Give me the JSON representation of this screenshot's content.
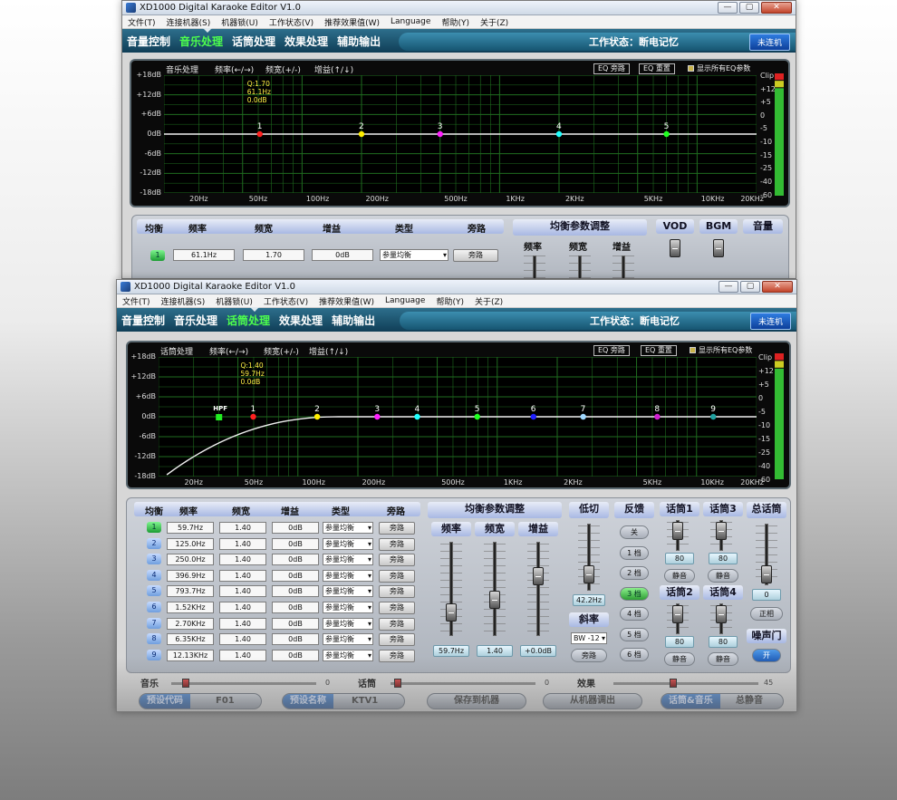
{
  "app": {
    "title": "XD1000 Digital Karaoke Editor V1.0",
    "menu": [
      "文件(T)",
      "连接机器(S)",
      "机器锁(U)",
      "工作状态(V)",
      "推荐效果值(W)",
      "Language",
      "帮助(Y)",
      "关于(Z)"
    ],
    "nav_tabs": [
      "音量控制",
      "音乐处理",
      "话筒处理",
      "效果处理",
      "辅助输出"
    ],
    "status_text": "工作状态：断电记忆",
    "connect_button": "未连机",
    "window_buttons": [
      "—",
      "▢",
      "✕"
    ]
  },
  "back_window": {
    "active_tab": "音乐处理",
    "eq_header": {
      "section": "音乐处理",
      "freq_hint": "频率(←/→)",
      "bw_hint": "频宽(+/-)",
      "gain_hint": "增益(↑/↓)",
      "bypass_btn": "EQ 旁路",
      "reset_btn": "EQ 重置",
      "show_all": "显示所有EQ参数"
    },
    "tooltip": [
      "Q:1.70",
      "61.1Hz",
      "0.0dB"
    ],
    "points": [
      "1",
      "2",
      "3",
      "4",
      "5"
    ],
    "table_headers": [
      "均衡",
      "频率",
      "频宽",
      "增益",
      "类型",
      "旁路"
    ],
    "row": {
      "num": "1",
      "freq": "61.1Hz",
      "bw": "1.70",
      "gain": "0dB",
      "type": "参量均衡",
      "bypass": "旁路"
    },
    "adjust_title": "均衡参数调整",
    "adjust_cols": [
      "频率",
      "频宽",
      "增益"
    ],
    "right_titles": [
      "VOD",
      "BGM",
      "音量"
    ]
  },
  "front_window": {
    "active_tab": "话筒处理",
    "eq_header": {
      "section": "话筒处理",
      "freq_hint": "频率(←/→)",
      "bw_hint": "频宽(+/-)",
      "gain_hint": "增益(↑/↓)",
      "bypass_btn": "EQ 旁路",
      "reset_btn": "EQ 重置",
      "show_all": "显示所有EQ参数"
    },
    "tooltip": [
      "Q:1.40",
      "59.7Hz",
      "0.0dB"
    ],
    "hpf_label": "HPF",
    "points": [
      "1",
      "2",
      "3",
      "4",
      "5",
      "6",
      "7",
      "8",
      "9"
    ],
    "table_headers": [
      "均衡",
      "频率",
      "频宽",
      "增益",
      "类型",
      "旁路"
    ],
    "rows": [
      {
        "num": "1",
        "freq": "59.7Hz",
        "bw": "1.40",
        "gain": "0dB",
        "type": "参量均衡",
        "bypass": "旁路"
      },
      {
        "num": "2",
        "freq": "125.0Hz",
        "bw": "1.40",
        "gain": "0dB",
        "type": "参量均衡",
        "bypass": "旁路"
      },
      {
        "num": "3",
        "freq": "250.0Hz",
        "bw": "1.40",
        "gain": "0dB",
        "type": "参量均衡",
        "bypass": "旁路"
      },
      {
        "num": "4",
        "freq": "396.9Hz",
        "bw": "1.40",
        "gain": "0dB",
        "type": "参量均衡",
        "bypass": "旁路"
      },
      {
        "num": "5",
        "freq": "793.7Hz",
        "bw": "1.40",
        "gain": "0dB",
        "type": "参量均衡",
        "bypass": "旁路"
      },
      {
        "num": "6",
        "freq": "1.52KHz",
        "bw": "1.40",
        "gain": "0dB",
        "type": "参量均衡",
        "bypass": "旁路"
      },
      {
        "num": "7",
        "freq": "2.70KHz",
        "bw": "1.40",
        "gain": "0dB",
        "type": "参量均衡",
        "bypass": "旁路"
      },
      {
        "num": "8",
        "freq": "6.35KHz",
        "bw": "1.40",
        "gain": "0dB",
        "type": "参量均衡",
        "bypass": "旁路"
      },
      {
        "num": "9",
        "freq": "12.13KHz",
        "bw": "1.40",
        "gain": "0dB",
        "type": "参量均衡",
        "bypass": "旁路"
      }
    ],
    "adjust_title": "均衡参数调整",
    "adjust_cols": [
      "频率",
      "频宽",
      "增益"
    ],
    "adjust_values": [
      "59.7Hz",
      "1.40",
      "+0.0dB"
    ],
    "lowcut": {
      "title": "低切",
      "value": "42.2Hz",
      "slope_title": "斜率",
      "slope_value": "BW -12",
      "bypass": "旁路"
    },
    "feedback": {
      "title": "反馈",
      "options": [
        "关",
        "1 档",
        "2 档",
        "3 档",
        "4 档",
        "5 档",
        "6 档"
      ],
      "selected": "3 档"
    },
    "mics": [
      {
        "title": "话筒1",
        "value": "80",
        "mute": "静音"
      },
      {
        "title": "话筒3",
        "value": "80",
        "mute": "静音"
      },
      {
        "title": "话筒2",
        "value": "80",
        "mute": "静音"
      },
      {
        "title": "话筒4",
        "value": "80",
        "mute": "静音"
      }
    ],
    "master": {
      "title": "总话筒",
      "value": "0",
      "phase": "正相",
      "gate_title": "噪声门",
      "gate_btn": "开"
    },
    "mixer": [
      {
        "label": "音乐",
        "value": "0"
      },
      {
        "label": "话筒",
        "value": "0"
      },
      {
        "label": "效果",
        "value": "45"
      }
    ],
    "bottom": {
      "preset_code_label": "预设代码",
      "preset_code": "F01",
      "preset_name_label": "预设名称",
      "preset_name": "KTV1",
      "save_btn": "保存到机器",
      "load_btn": "从机器调出",
      "link_label": "话筒&音乐",
      "mute_all": "总静音"
    }
  },
  "eq_chart": {
    "y_ticks": [
      "+18dB",
      "+12dB",
      "+6dB",
      "0dB",
      "-6dB",
      "-12dB",
      "-18dB"
    ],
    "x_ticks": [
      "20Hz",
      "50Hz",
      "100Hz",
      "200Hz",
      "500Hz",
      "1KHz",
      "2KHz",
      "5KHz",
      "10KHz",
      "20KHz"
    ],
    "meter_ticks": [
      "Clip",
      "+12",
      "+5",
      "0",
      "-5",
      "-10",
      "-15",
      "-25",
      "-40",
      "-60"
    ]
  },
  "colors": {
    "point_colors": [
      "#ff2020",
      "#ffee00",
      "#ff20ff",
      "#20ffff",
      "#20ff20",
      "#2020ff",
      "#a0d8ff",
      "#d020d0",
      "#20a0a0"
    ],
    "grid": "#1f6b1f",
    "nav_bg": "#1a5470",
    "active_tab": "#4dff4d"
  }
}
